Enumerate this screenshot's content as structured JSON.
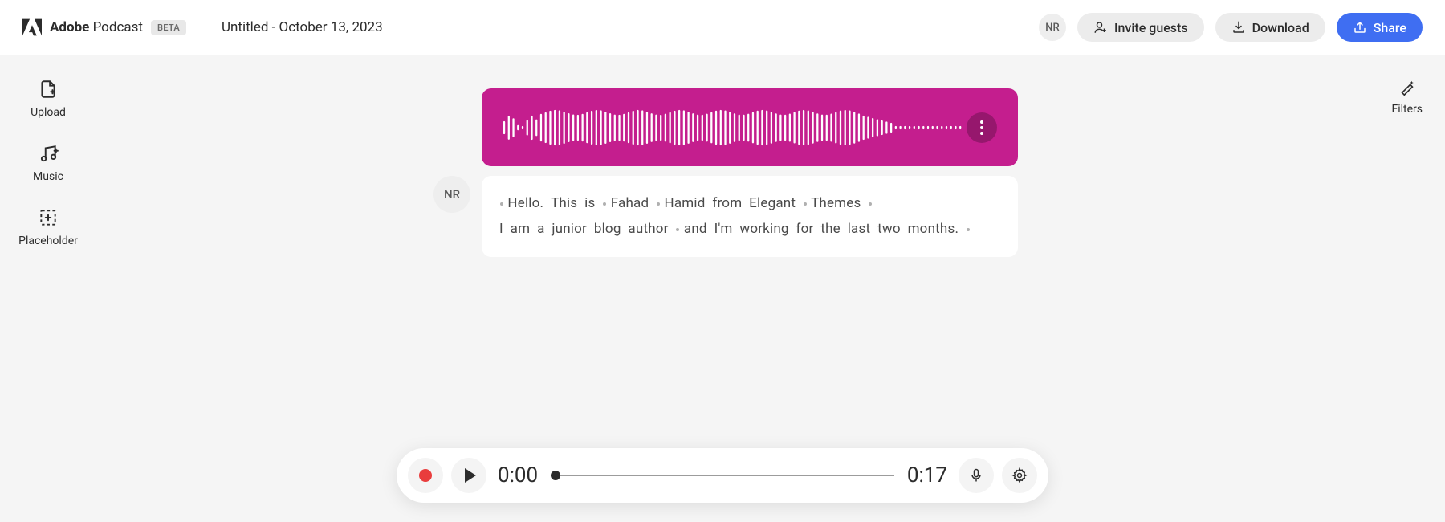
{
  "header": {
    "brand_name": "Adobe",
    "brand_product": "Podcast",
    "beta_label": "BETA",
    "project_title": "Untitled - October 13, 2023",
    "avatar_initials": "NR",
    "invite_label": "Invite guests",
    "download_label": "Download",
    "share_label": "Share"
  },
  "left_toolbar": {
    "upload_label": "Upload",
    "music_label": "Music",
    "placeholder_label": "Placeholder"
  },
  "right_toolbar": {
    "filters_label": "Filters"
  },
  "clip": {
    "accent_color": "#c41e8e",
    "speaker_initials": "NR"
  },
  "transcript": {
    "line1_words": [
      "Hello.",
      "This",
      "is",
      "Fahad",
      "Hamid",
      "from",
      "Elegant",
      "Themes"
    ],
    "line1_dots_before": [
      0,
      3,
      4,
      7
    ],
    "line1_dot_after": true,
    "line2_words": [
      "I",
      "am",
      "a",
      "junior",
      "blog",
      "author",
      "and",
      "I'm",
      "working",
      "for",
      "the",
      "last",
      "two",
      "months."
    ],
    "line2_dots_before": [
      6
    ],
    "line2_dot_after": true
  },
  "player": {
    "current": "0:00",
    "total": "0:17"
  }
}
